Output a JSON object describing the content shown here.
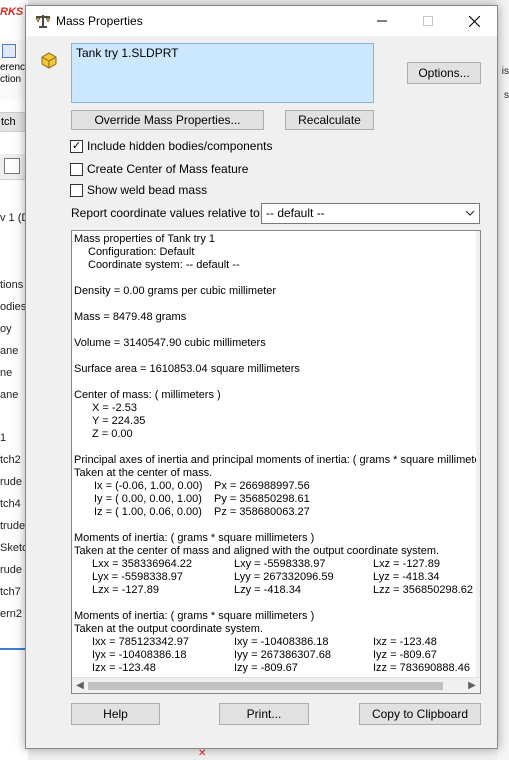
{
  "background": {
    "brand_text": "RKS",
    "ribbon_lines": [
      "erenc",
      "ction"
    ],
    "tab_text": "tch",
    "tree_label": "v 1  (D",
    "tree_items": [
      "tions",
      "odies",
      "oy",
      "ane",
      "ne",
      "ane",
      "1",
      "tch2",
      "rude",
      "tch4",
      "trude",
      "Sketc",
      "rude",
      "tch7",
      "ern2"
    ],
    "right_texts": [
      "is",
      "s"
    ]
  },
  "dialog": {
    "title": "Mass Properties",
    "selected_file": "Tank try 1.SLDPRT",
    "options_label": "Options...",
    "override_label": "Override Mass Properties...",
    "recalculate_label": "Recalculate",
    "checkbox_include_hidden": {
      "label": "Include hidden bodies/components",
      "checked": true
    },
    "checkbox_center_of_mass": {
      "label": "Create Center of Mass feature",
      "checked": false
    },
    "checkbox_weld_bead": {
      "label": "Show weld bead mass",
      "checked": false
    },
    "coord_label": "Report coordinate values relative to:",
    "coord_value": "-- default --",
    "help_label": "Help",
    "print_label": "Print...",
    "copy_label": "Copy to Clipboard"
  },
  "results": {
    "header": "Mass properties of Tank try 1",
    "configuration": "Configuration: Default",
    "coordinate_system": "Coordinate system: -- default --",
    "density": "Density = 0.00 grams per cubic millimeter",
    "mass": "Mass = 8479.48 grams",
    "volume": "Volume = 3140547.90 cubic millimeters",
    "surface_area": "Surface area = 1610853.04  square millimeters",
    "center_of_mass_title": "Center of mass: ( millimeters )",
    "com_x": "X = -2.53",
    "com_y": "Y = 224.35",
    "com_z": "Z = 0.00",
    "principal_title": "Principal axes of inertia and principal moments of inertia: ( grams *  square millimeters )",
    "principal_taken": "Taken at the center of mass.",
    "principal_rows": [
      {
        "axis": "Ix = (-0.06,  1.00,  0.00)",
        "moment": "Px = 266988997.56"
      },
      {
        "axis": "Iy = ( 0.00,  0.00,  1.00)",
        "moment": "Py = 356850298.61"
      },
      {
        "axis": "Iz = ( 1.00,  0.06,  0.00)",
        "moment": "Pz = 358680063.27"
      }
    ],
    "moments_com_title": "Moments of inertia: ( grams *  square millimeters )",
    "moments_com_taken": "Taken at the center of mass and aligned with the output coordinate system.",
    "moments_com_rows": [
      [
        "Lxx = 358336964.22",
        "Lxy = -5598338.97",
        "Lxz = -127.89"
      ],
      [
        "Lyx = -5598338.97",
        "Lyy = 267332096.59",
        "Lyz = -418.34"
      ],
      [
        "Lzx = -127.89",
        "Lzy = -418.34",
        "Lzz = 356850298.62"
      ]
    ],
    "moments_out_title": "Moments of inertia: ( grams *  square millimeters )",
    "moments_out_taken": "Taken at the output coordinate system.",
    "moments_out_rows": [
      [
        "Ixx = 785123342.97",
        "Ixy = -10408386.18",
        "Ixz = -123.48"
      ],
      [
        "Iyx = -10408386.18",
        "Iyy = 267386307.68",
        "Iyz = -809.67"
      ],
      [
        "Izx = -123.48",
        "Izy = -809.67",
        "Izz = 783690888.46"
      ]
    ]
  }
}
